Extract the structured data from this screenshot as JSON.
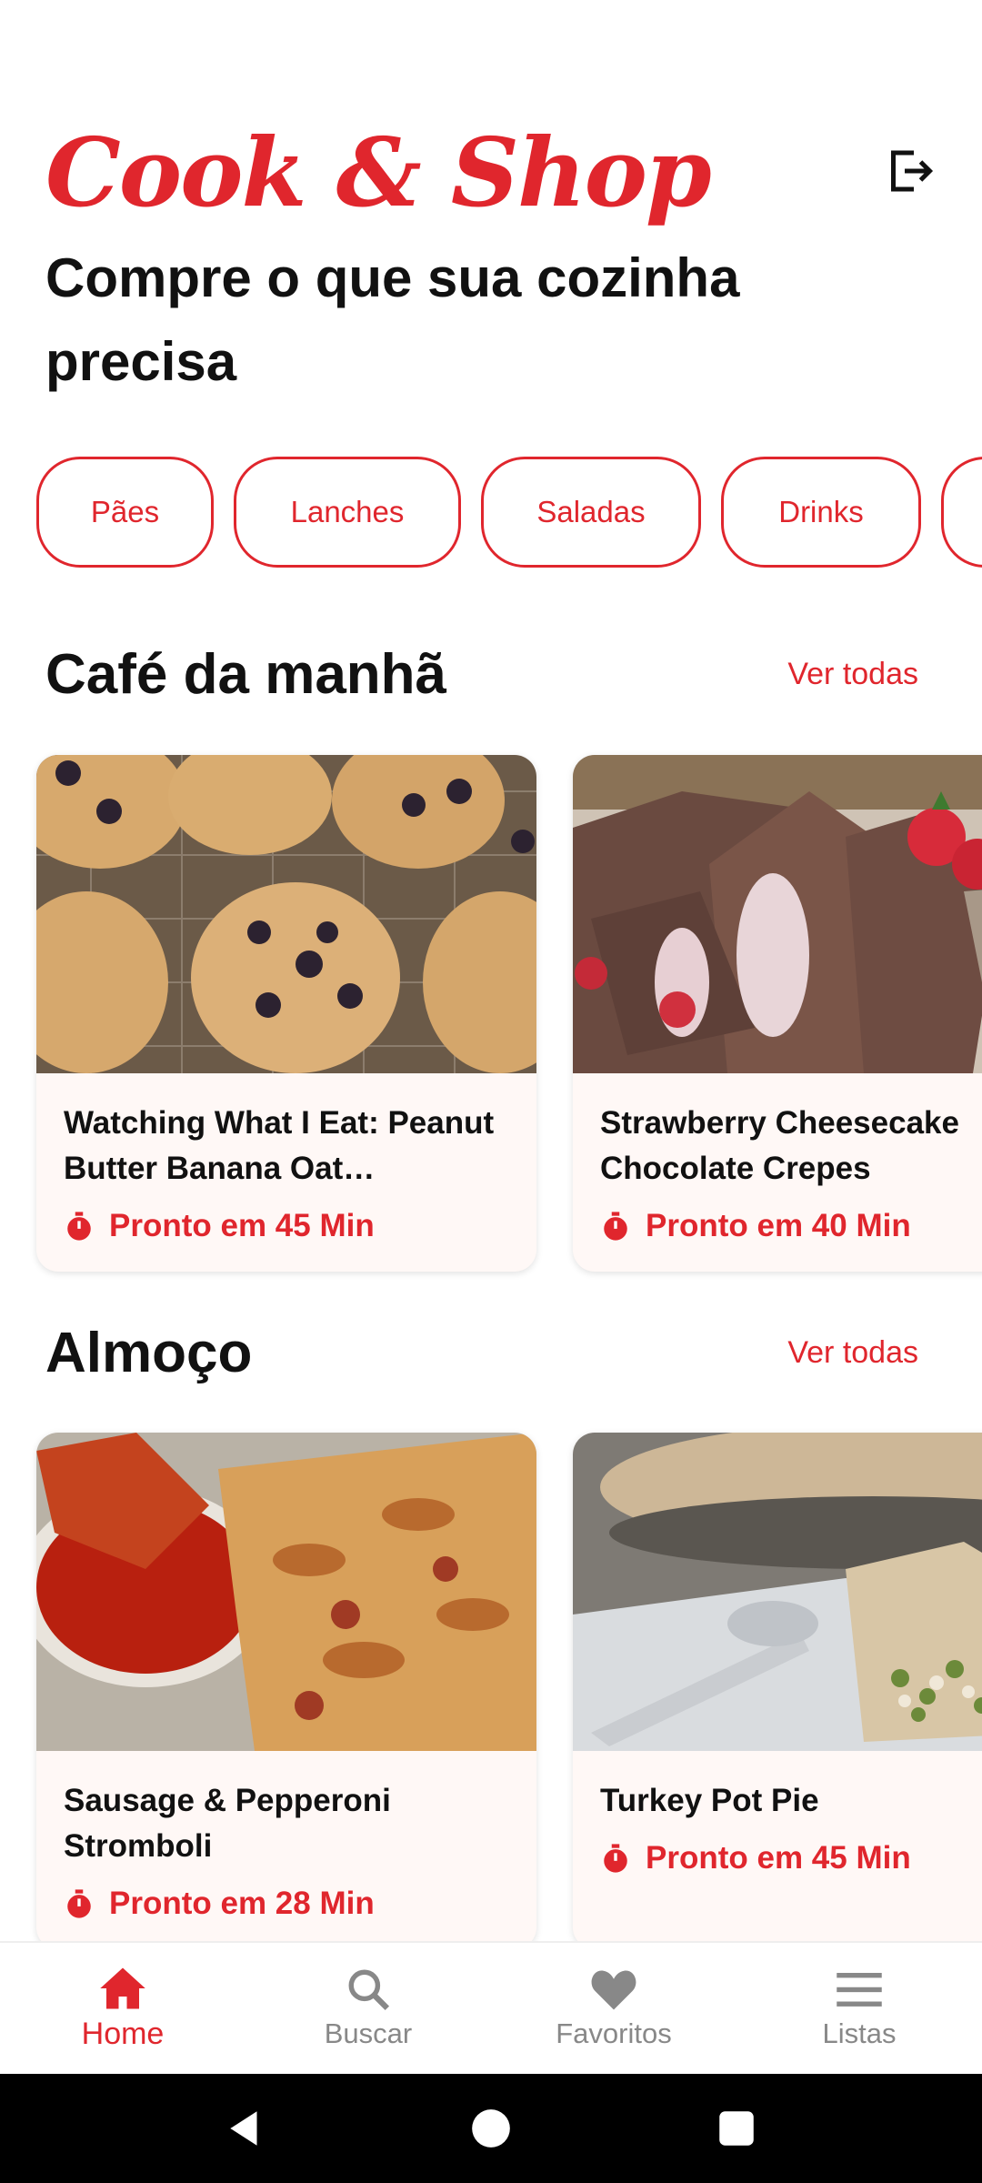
{
  "app": {
    "brand": "Cook & Shop",
    "subtitle": "Compre o que sua cozinha precisa"
  },
  "categories": [
    "Pães",
    "Lanches",
    "Saladas",
    "Drinks",
    ""
  ],
  "sections": [
    {
      "title": "Café da manhã",
      "see_all": "Ver todas",
      "cards": [
        {
          "title": "Watching What I Eat: Peanut Butter Banana Oat Breakfast…",
          "time": "Pronto em 45 Min"
        },
        {
          "title": "Strawberry Cheesecake Chocolate Crepes",
          "time": "Pronto em 40 Min"
        }
      ]
    },
    {
      "title": "Almoço",
      "see_all": "Ver todas",
      "cards": [
        {
          "title": "Sausage & Pepperoni Stromboli",
          "time": "Pronto em 28 Min"
        },
        {
          "title": "Turkey Pot Pie",
          "time": "Pronto em 45 Min"
        }
      ]
    }
  ],
  "bottom_nav": [
    {
      "label": "Home",
      "icon": "home-icon",
      "active": true
    },
    {
      "label": "Buscar",
      "icon": "search-icon",
      "active": false
    },
    {
      "label": "Favoritos",
      "icon": "heart-icon",
      "active": false
    },
    {
      "label": "Listas",
      "icon": "menu-icon",
      "active": false
    }
  ],
  "colors": {
    "accent": "#e0262d",
    "card_bg": "#fff8f6",
    "inactive": "#888888"
  }
}
